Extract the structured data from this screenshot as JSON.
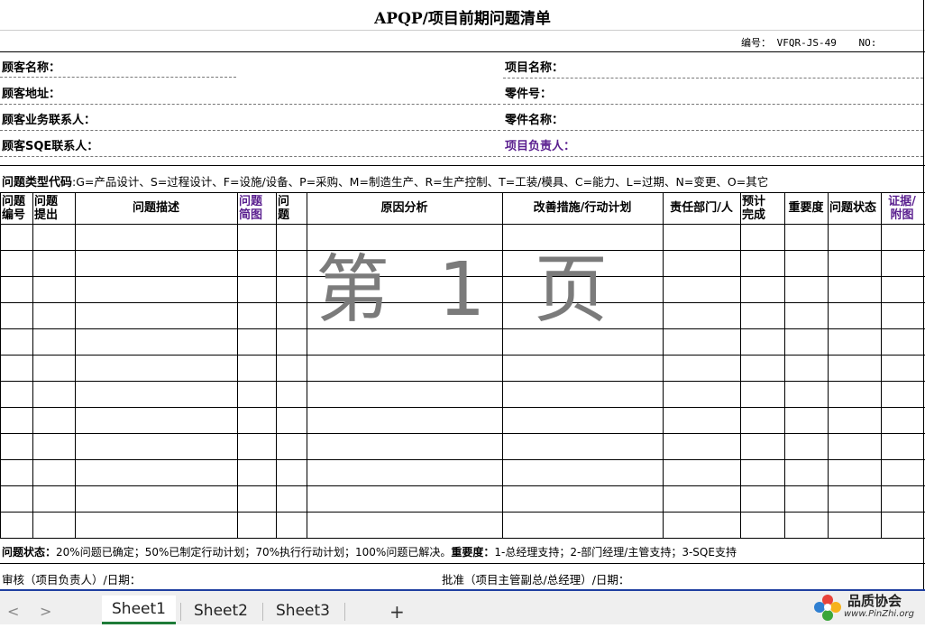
{
  "document": {
    "title": "APQP/项目前期问题清单",
    "code_label": "编号：",
    "code_value": "VFQR-JS-49",
    "no_label": "NO:",
    "fields_left": [
      "顾客名称：",
      "顾客地址：",
      "顾客业务联系人：",
      "顾客SQE联系人："
    ],
    "fields_right": [
      "项目名称：",
      "零件号：",
      "零件名称：",
      "项目负责人："
    ],
    "issue_types_label": "问题类型代码",
    "issue_types_text": ":G=产品设计、S=过程设计、F=设施/设备、P=采购、M=制造生产、R=生产控制、T=工装/模具、C=能力、L=过期、N=变更、O=其它",
    "headers": [
      "问题\n编号",
      "问题\n提出",
      "问题描述",
      "问题\n简图",
      "问\n题",
      "原因分析",
      "改善措施/行动计划",
      "责任部门/人",
      "预计\n完成",
      "重要度",
      "问题状态",
      "证据/\n附图"
    ],
    "watermark": "第 1 页",
    "status_label": "问题状态：",
    "status_text": "20%问题已确定；50%已制定行动计划；70%执行行动计划；100%问题已解决。",
    "importance_label": "重要度：",
    "importance_text": "1-总经理支持；2-部门经理/主管支持；3-SQE支持",
    "review_text": "审核（项目负责人）/日期：",
    "approve_text": "批准（项目主管副总/总经理）/日期："
  },
  "tabs": {
    "items": [
      "Sheet1",
      "Sheet2",
      "Sheet3"
    ],
    "add": "+",
    "prev": "<",
    "next": ">"
  },
  "logo": {
    "name": "品质协会",
    "url": "www.PinZhi.org"
  },
  "colors": {
    "accent_purple": "#5a1f8f",
    "tab_active_underline": "#1e7b38",
    "separator_blue": "#1f3fa0"
  }
}
